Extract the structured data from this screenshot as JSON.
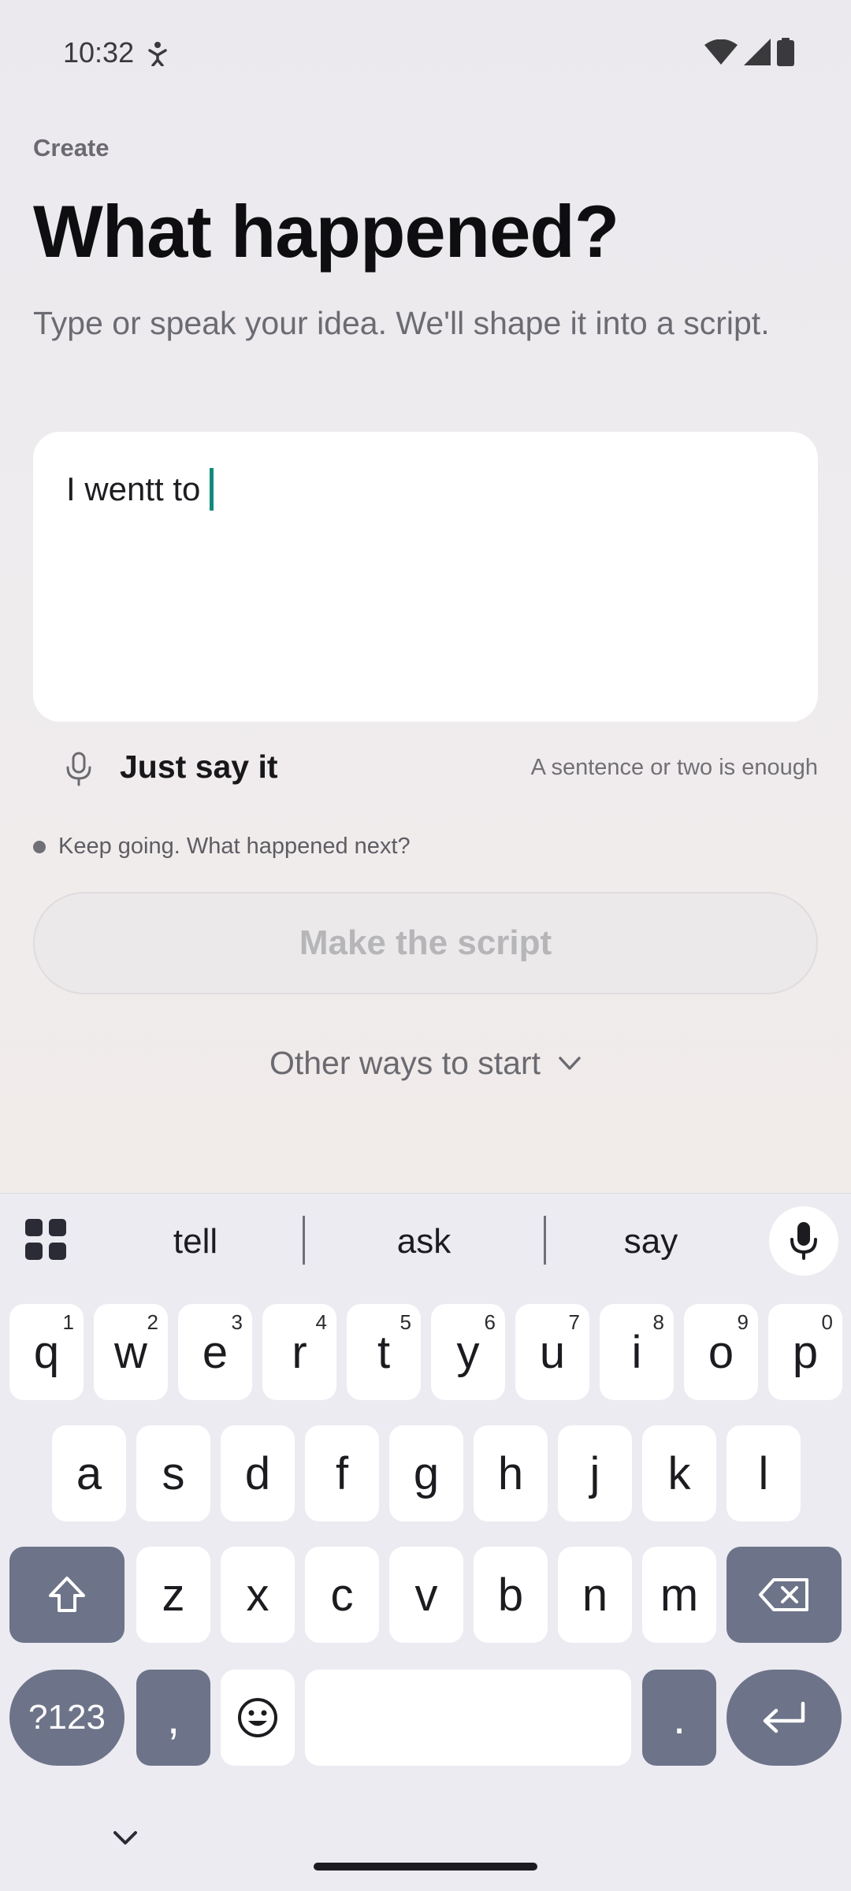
{
  "status_bar": {
    "time": "10:32",
    "icons": [
      "accessibility-icon",
      "wifi-icon",
      "signal-icon",
      "battery-icon"
    ]
  },
  "page": {
    "eyebrow": "Create",
    "title": "What happened?",
    "subtitle": "Type or speak your idea. We'll shape it into a script.",
    "input_value": "I wentt to",
    "voice": {
      "label": "Just say it",
      "hint": "A sentence or two is enough",
      "icon": "microphone-icon"
    },
    "status_hint": "Keep going. What happened next?",
    "primary_button": "Make the script",
    "secondary_link": "Other ways to start"
  },
  "keyboard": {
    "suggestions": [
      "tell",
      "ask",
      "say"
    ],
    "rows": [
      [
        {
          "k": "q",
          "h": "1"
        },
        {
          "k": "w",
          "h": "2"
        },
        {
          "k": "e",
          "h": "3"
        },
        {
          "k": "r",
          "h": "4"
        },
        {
          "k": "t",
          "h": "5"
        },
        {
          "k": "y",
          "h": "6"
        },
        {
          "k": "u",
          "h": "7"
        },
        {
          "k": "i",
          "h": "8"
        },
        {
          "k": "o",
          "h": "9"
        },
        {
          "k": "p",
          "h": "0"
        }
      ],
      [
        "a",
        "s",
        "d",
        "f",
        "g",
        "h",
        "j",
        "k",
        "l"
      ],
      [
        "z",
        "x",
        "c",
        "v",
        "b",
        "n",
        "m"
      ]
    ],
    "symbols_label": "?123",
    "comma": ",",
    "period": "."
  },
  "colors": {
    "accent_caret": "#118a7a",
    "dark_key": "#6d7388",
    "disabled_text": "#b6b5b8"
  }
}
